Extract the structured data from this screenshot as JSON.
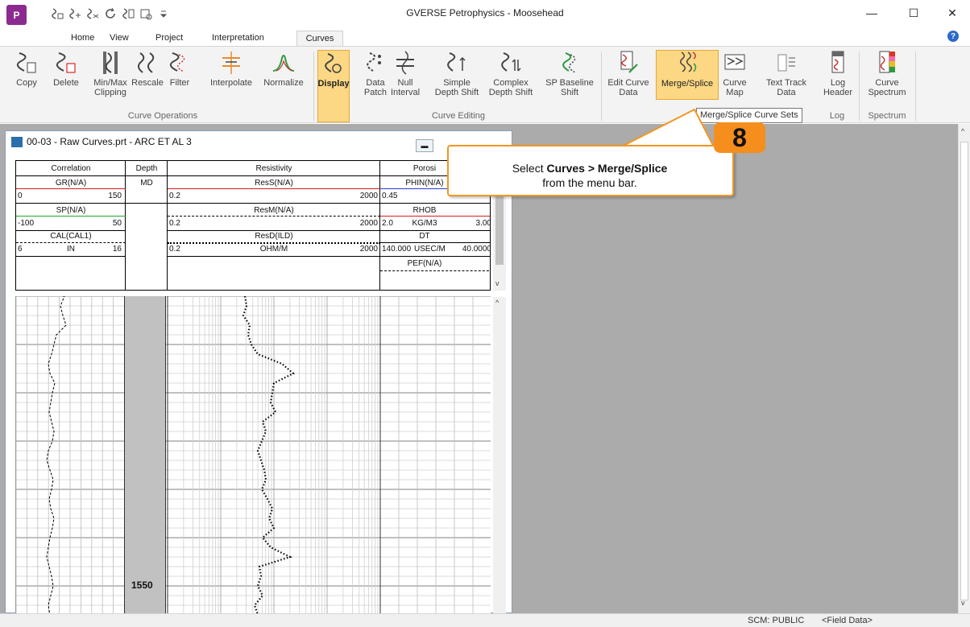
{
  "window": {
    "title": "GVERSE Petrophysics - Moosehead",
    "logo_text": "P",
    "minimize_glyph": "—",
    "maximize_glyph": "☐",
    "close_glyph": "✕"
  },
  "qat": {
    "icons": [
      "curve-tool-icon",
      "curve-tool-icon",
      "curve-tool-icon",
      "refresh-icon",
      "curve-tool-icon",
      "settings-icon",
      "customize-icon"
    ]
  },
  "tabs": [
    {
      "label": "Home"
    },
    {
      "label": "View"
    },
    {
      "label": "Project"
    },
    {
      "label": "Interpretation"
    },
    {
      "label": "Curves",
      "active": true
    }
  ],
  "help_glyph": "?",
  "ribbon": {
    "groups": [
      {
        "label": "Curve Operations"
      },
      {
        "label": "Curve Editing"
      },
      {
        "label": "Log"
      },
      {
        "label": "Spectrum"
      }
    ],
    "buttons": [
      {
        "label": "Copy"
      },
      {
        "label": "Delete"
      },
      {
        "label": "Min/Max Clipping"
      },
      {
        "label": "Rescale"
      },
      {
        "label": "Filter"
      },
      {
        "label": "Interpolate"
      },
      {
        "label": "Normalize"
      },
      {
        "label": "Display",
        "selected": true
      },
      {
        "label": "Data Patch"
      },
      {
        "label": "Null Interval"
      },
      {
        "label": "Simple Depth Shift"
      },
      {
        "label": "Complex Depth Shift"
      },
      {
        "label": "SP Baseline Shift"
      },
      {
        "label": "Edit Curve Data"
      },
      {
        "label": "Merge/Splice",
        "selected": true
      },
      {
        "label": "Curve Map"
      },
      {
        "label": "Text Track Data"
      },
      {
        "label": "Log Header"
      },
      {
        "label": "Curve Spectrum"
      }
    ]
  },
  "tooltip": "Merge/Splice Curve Sets",
  "child_window": {
    "title": "00-03 - Raw Curves.prt - ARC ET AL 3",
    "tracks": [
      {
        "title": "Correlation",
        "curves": [
          {
            "name": "GR(N/A)",
            "left": "0",
            "right": "150",
            "color": "#d81b1b",
            "style": "solid"
          },
          {
            "name": "SP(N/A)",
            "left": "-100",
            "right": "50",
            "color": "#1fa82a",
            "style": "solid"
          },
          {
            "name": "CAL(CAL1)",
            "left": "6",
            "unit": "IN",
            "right": "16",
            "color": "#000000",
            "style": "dashed"
          }
        ]
      },
      {
        "title": "Depth",
        "unit": "MD"
      },
      {
        "title": "Resistivity",
        "curves": [
          {
            "name": "ResS(N/A)",
            "left": "0.2",
            "right": "2000",
            "color": "#d81b1b",
            "style": "solid"
          },
          {
            "name": "ResM(N/A)",
            "left": "0.2",
            "right": "2000",
            "color": "#000000",
            "style": "dashed"
          },
          {
            "name": "ResD(ILD)",
            "left": "0.2",
            "unit": "OHM/M",
            "right": "2000",
            "color": "#000000",
            "style": "dotted"
          }
        ]
      },
      {
        "title": "Porosi",
        "curves": [
          {
            "name": "PHIN(N/A)",
            "left": "0.45",
            "right": "",
            "color": "#2a3ad8",
            "style": "solid"
          },
          {
            "name": "RHOB",
            "left": "2.0",
            "unit": "KG/M3",
            "right": "3.00",
            "color": "#d81b1b",
            "style": "solid"
          },
          {
            "name": "DT",
            "left": "140.000",
            "unit": "USEC/M",
            "right": "40.0000",
            "color": "#000000",
            "style": "solid"
          },
          {
            "name": "PEF(N/A)",
            "left": "",
            "right": "",
            "color": "#000000",
            "style": "dashed"
          }
        ]
      }
    ],
    "depth_label": "1550"
  },
  "callout": {
    "prefix": "Select ",
    "bold": "Curves > Merge/Splice",
    "suffix": "from the menu bar.",
    "step": "8",
    "color": "#f29623"
  },
  "status": {
    "scm": "SCM: PUBLIC",
    "field": "<Field Data>"
  }
}
